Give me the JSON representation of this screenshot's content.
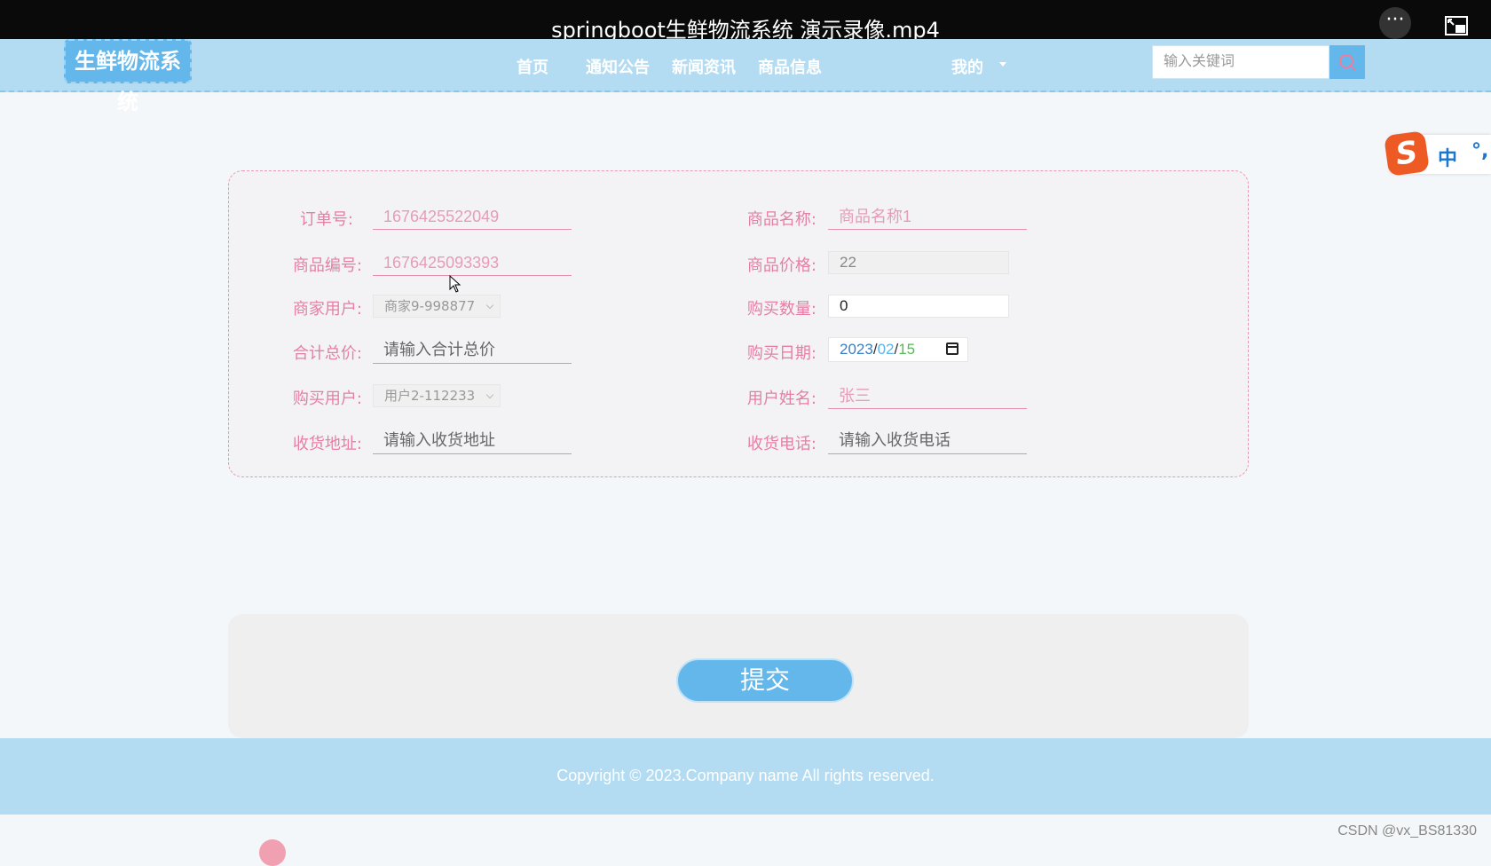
{
  "video": {
    "title": "springboot生鲜物流系统 演示录像.mp4",
    "more_icon": "ellipsis-icon",
    "pip_icon": "picture-in-picture-icon"
  },
  "navbar": {
    "logo": "生鲜物流系统",
    "items": [
      {
        "label": "首页"
      },
      {
        "label": "通知公告"
      },
      {
        "label": "新闻资讯"
      },
      {
        "label": "商品信息"
      },
      {
        "label": "我的"
      }
    ],
    "search": {
      "placeholder": "输入关键词",
      "icon": "search-icon"
    }
  },
  "ime": {
    "logo": "S",
    "mode": "中",
    "punctuation": "°,"
  },
  "form": {
    "order_no": {
      "label": "订单号:",
      "value": "1676425522049"
    },
    "product_name": {
      "label": "商品名称:",
      "value": "商品名称1"
    },
    "product_code": {
      "label": "商品编号:",
      "value": "1676425093393"
    },
    "product_price": {
      "label": "商品价格:",
      "value": "22"
    },
    "merchant_user": {
      "label": "商家用户:",
      "value": "商家9-998877"
    },
    "quantity": {
      "label": "购买数量:",
      "value": "0"
    },
    "total_price": {
      "label": "合计总价:",
      "placeholder": "请输入合计总价"
    },
    "purchase_date": {
      "label": "购买日期:",
      "year": "2023",
      "month": "02",
      "day": "15",
      "sep": "/"
    },
    "buyer_user": {
      "label": "购买用户:",
      "value": "用户2-112233"
    },
    "user_name": {
      "label": "用户姓名:",
      "value": "张三"
    },
    "address": {
      "label": "收货地址:",
      "placeholder": "请输入收货地址"
    },
    "phone": {
      "label": "收货电话:",
      "placeholder": "请输入收货电话"
    }
  },
  "submit": {
    "label": "提交"
  },
  "footer": {
    "copyright": "Copyright © 2023.Company name All rights reserved."
  },
  "watermark": "CSDN @vx_BS81330",
  "colors": {
    "accent": "#64b7ea",
    "nav_bg": "#b3dcf2",
    "label_pink": "#e57fa4"
  }
}
